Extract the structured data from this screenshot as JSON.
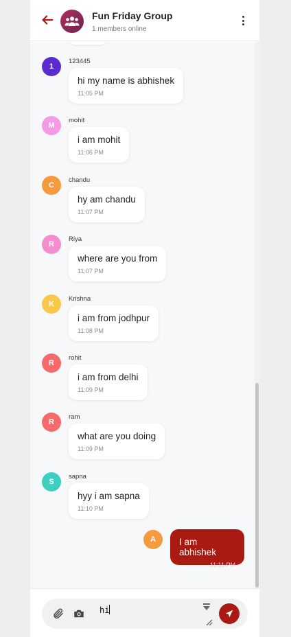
{
  "header": {
    "title": "Fun Friday Group",
    "subtitle": "1 members online"
  },
  "messages": [
    {
      "initial": "1",
      "sender": "123445",
      "text": "hi my name is abhishek",
      "time": "11:05 PM",
      "color": "#5b2bd0"
    },
    {
      "initial": "M",
      "sender": "mohit",
      "text": "i am mohit",
      "time": "11:06 PM",
      "color": "#f49ae6"
    },
    {
      "initial": "C",
      "sender": "chandu",
      "text": "hy am chandu",
      "time": "11:07 PM",
      "color": "#f59a3d"
    },
    {
      "initial": "R",
      "sender": "Riya",
      "text": "where are you from",
      "time": "11:07 PM",
      "color": "#f58ccf"
    },
    {
      "initial": "K",
      "sender": "Krishna",
      "text": "i am from jodhpur",
      "time": "11:08 PM",
      "color": "#f8c84a"
    },
    {
      "initial": "R",
      "sender": "rohit",
      "text": "i am from delhi",
      "time": "11:09 PM",
      "color": "#f56a6a"
    },
    {
      "initial": "R",
      "sender": "ram",
      "text": "what are you doing",
      "time": "11:09 PM",
      "color": "#f56a6a"
    },
    {
      "initial": "S",
      "sender": "sapna",
      "text": "hyy i am sapna",
      "time": "11:10 PM",
      "color": "#3fcfc0"
    }
  ],
  "mine": {
    "initial": "A",
    "text": "I am abhishek",
    "time": "11:11 PM",
    "color": "#f59a3d"
  },
  "composer": {
    "value": "hi"
  },
  "colors": {
    "accent": "#a81a12",
    "group_avatar": "#8a2a55"
  },
  "icons": {
    "back": "arrow-left-icon",
    "group": "group-icon",
    "menu": "kebab-menu-icon",
    "attach": "paperclip-icon",
    "camera": "camera-icon",
    "send": "send-icon"
  }
}
